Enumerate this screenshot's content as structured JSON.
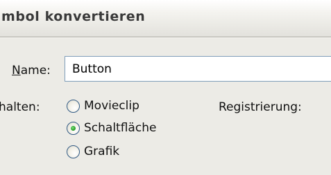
{
  "dialog": {
    "title": "mbol konvertieren"
  },
  "name_field": {
    "label_mnemonic": "N",
    "label_rest": "ame:",
    "value": "Button"
  },
  "behavior": {
    "label": "halten:",
    "options": [
      {
        "label": "Movieclip",
        "selected": false
      },
      {
        "label": "Schaltfläche",
        "selected": true
      },
      {
        "label": "Grafik",
        "selected": false
      }
    ]
  },
  "registration": {
    "label": "Registrierung:"
  },
  "colors": {
    "background": "#ecebe6",
    "input_border": "#7f9db9",
    "radio_border": "#2f5883",
    "radio_selected": "#2fa52f"
  }
}
